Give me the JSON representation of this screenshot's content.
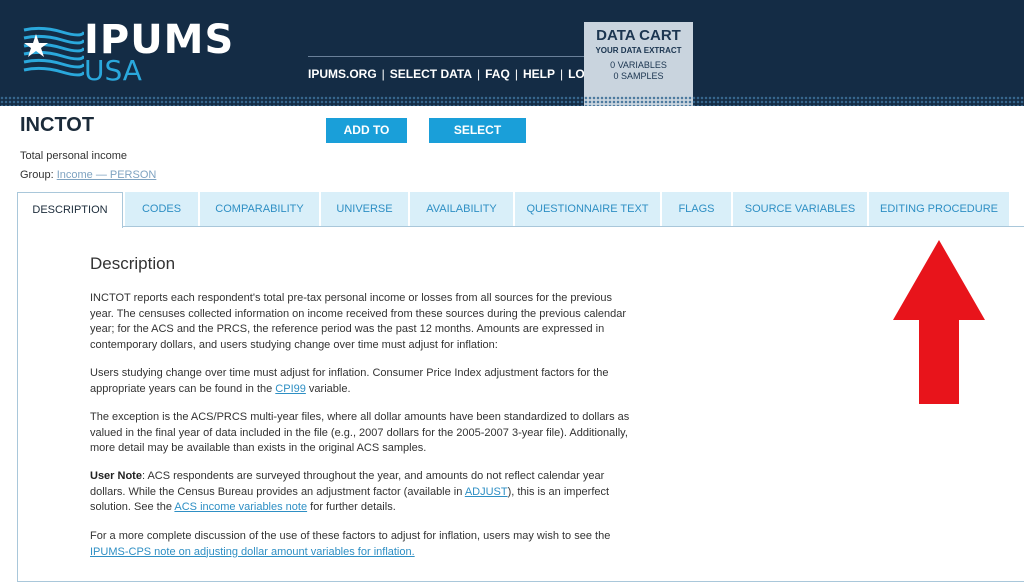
{
  "header": {
    "logo_main": "IPUMS",
    "logo_sub": "USA",
    "nav": [
      "IPUMS.ORG",
      "SELECT DATA",
      "FAQ",
      "HELP",
      "LOGIN"
    ],
    "cart": {
      "title": "DATA CART",
      "subtitle": "YOUR DATA EXTRACT",
      "variables": "0  VARIABLES",
      "samples": "0  SAMPLES"
    }
  },
  "variable": {
    "name": "INCTOT",
    "label": "Total personal income",
    "group_prefix": "Group: ",
    "group_link": "Income — PERSON"
  },
  "buttons": {
    "add_to_cart": "ADD TO CART",
    "select_samples": "SELECT SAMPLES"
  },
  "tabs": [
    {
      "label": "DESCRIPTION",
      "active": true
    },
    {
      "label": "CODES"
    },
    {
      "label": "COMPARABILITY"
    },
    {
      "label": "UNIVERSE"
    },
    {
      "label": "AVAILABILITY"
    },
    {
      "label": "QUESTIONNAIRE TEXT"
    },
    {
      "label": "FLAGS"
    },
    {
      "label": "SOURCE VARIABLES"
    },
    {
      "label": "EDITING PROCEDURE"
    }
  ],
  "content": {
    "title": "Description",
    "p1": "INCTOT reports each respondent's total pre-tax personal income or losses from all sources for the previous year. The censuses collected information on income received from these sources during the previous calendar year; for the ACS and the PRCS, the reference period was the past 12 months. Amounts are expressed in contemporary dollars, and users studying change over time must adjust for inflation:",
    "p2_a": "Users studying change over time must adjust for inflation. Consumer Price Index adjustment factors for the appropriate years can be found in the ",
    "p2_link": "CPI99",
    "p2_b": " variable.",
    "p3": "The exception is the ACS/PRCS multi-year files, where all dollar amounts have been standardized to dollars as valued in the final year of data included in the file (e.g., 2007 dollars for the 2005-2007 3-year file). Additionally, more detail may be available than exists in the original ACS samples.",
    "p4_bold": "User Note",
    "p4_a": ": ACS respondents are surveyed throughout the year, and amounts do not reflect calendar year dollars. While the Census Bureau provides an adjustment factor (available in ",
    "p4_link1": "ADJUST",
    "p4_b": "), this is an imperfect solution. See the ",
    "p4_link2": "ACS income variables note",
    "p4_c": " for further details.",
    "p5_a": "For a more complete discussion of the use of these factors to adjust for inflation, users may wish to see the ",
    "p5_link": "IPUMS-CPS note on adjusting dollar amount variables for inflation."
  },
  "colors": {
    "header_bg": "#142c45",
    "accent": "#1a9fd9",
    "tab_bg": "#d9eff9",
    "arrow": "#e8141b"
  }
}
